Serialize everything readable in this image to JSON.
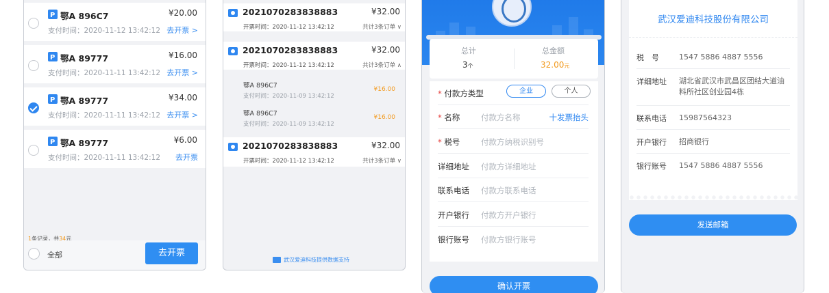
{
  "panel1": {
    "items": [
      {
        "plate": "鄂A 896C7",
        "price": "¥20.00",
        "time": "支付时间：2020-11-12 13:42:12",
        "action": "去开票 >",
        "checked": false
      },
      {
        "plate": "鄂A 89777",
        "price": "¥16.00",
        "time": "支付时间：2020-11-11 13:42:12",
        "action": "去开票 >",
        "checked": false
      },
      {
        "plate": "鄂A 89777",
        "price": "¥34.00",
        "time": "支付时间：2020-11-11 13:42:12",
        "action": "去开票 >",
        "checked": true
      },
      {
        "plate": "鄂A 89777",
        "price": "¥6.00",
        "time": "支付时间：2020-11-11 13:42:12",
        "action": "去开票",
        "checked": false
      }
    ],
    "footer": {
      "count": "1",
      "mid": "条记录，共",
      "amount": "34",
      "unit": "元"
    },
    "select_all": "全部",
    "submit": "去开票"
  },
  "panel2": {
    "invoices": [
      {
        "no": "2021070283838883",
        "price": "¥32.00",
        "time": "开票时间：2020-11-12 13:42:12",
        "count": "共计3条订单 ∨"
      },
      {
        "no": "2021070283838883",
        "price": "¥32.00",
        "time": "开票时间：2020-11-12 13:42:12",
        "count": "共计3条订单 ∧"
      },
      {
        "no": "2021070283838883",
        "price": "¥32.00",
        "time": "开票时间：2020-11-12 13:42:12",
        "count": "共计3条订单 ∨"
      }
    ],
    "sub_items": [
      {
        "plate": "鄂A 896C7",
        "time": "支付时间：2020-11-09 13:42:12",
        "price": "¥16.00"
      },
      {
        "plate": "鄂A 896C7",
        "time": "支付时间：2020-11-09 13:42:12",
        "price": "¥16.00"
      }
    ],
    "footer": "武汉爱迪科技提供数据支持"
  },
  "panel3": {
    "summary": {
      "total_label": "总计",
      "total_value": "3",
      "total_unit": "个",
      "amount_label": "总金额",
      "amount_value": "32.00",
      "amount_unit": "元"
    },
    "fields": [
      {
        "label": "付款方类型",
        "required": true
      },
      {
        "label": "名称",
        "required": true,
        "placeholder": "付款方名称"
      },
      {
        "label": "税号",
        "required": true,
        "placeholder": "付款方纳税识别号"
      },
      {
        "label": "详细地址",
        "required": false,
        "placeholder": "付款方详细地址"
      },
      {
        "label": "联系电话",
        "required": false,
        "placeholder": "付款方联系电话"
      },
      {
        "label": "开户银行",
        "required": false,
        "placeholder": "付款方开户银行"
      },
      {
        "label": "银行账号",
        "required": false,
        "placeholder": "付款方银行账号"
      }
    ],
    "type_options": [
      "企业",
      "个人"
    ],
    "title_link": "十发票抬头",
    "confirm": "确认开票"
  },
  "panel4": {
    "company": "武汉爱迪科技股份有限公司",
    "rows": [
      {
        "label": "税　号",
        "value": "1547 5886 4887 5556"
      },
      {
        "label": "详细地址",
        "value": "湖北省武汉市武昌区团结大道油料所社区创业园4栋"
      },
      {
        "label": "联系电话",
        "value": "15987564323"
      },
      {
        "label": "开户银行",
        "value": "招商银行"
      },
      {
        "label": "银行账号",
        "value": "1547 5886 4887 5556"
      }
    ],
    "send": "发送邮箱"
  },
  "colors": {
    "accent": "#2f87f0",
    "orange": "#f29a1e",
    "background": "#f1f2f5"
  }
}
